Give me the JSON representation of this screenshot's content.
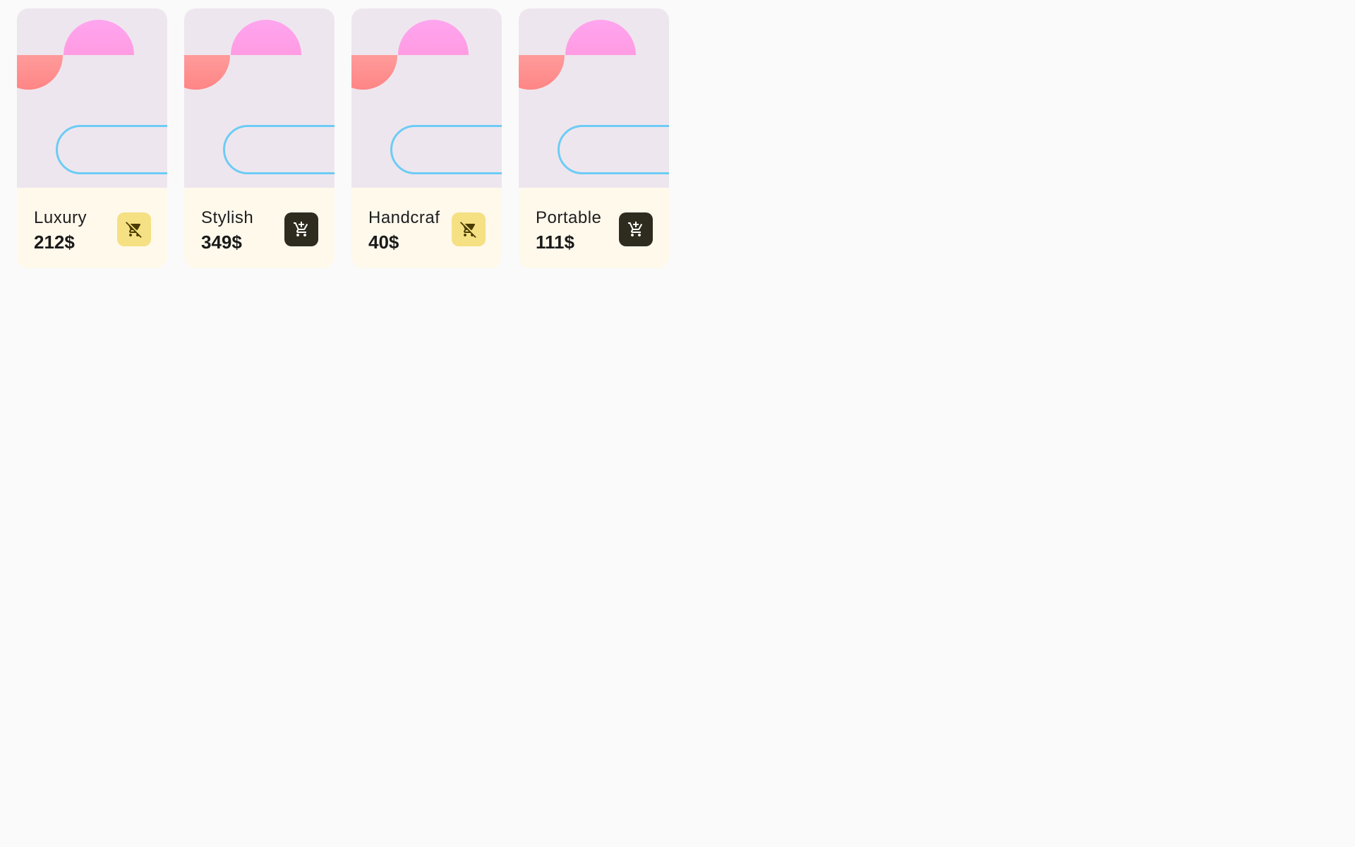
{
  "products": [
    {
      "name": "Luxury",
      "price": "212$",
      "cart_action": "remove",
      "cart_icon": "remove-shopping-cart-icon",
      "button_bg": "#F5E083",
      "icon_color": "#4A3C00"
    },
    {
      "name": "Stylish",
      "price": "349$",
      "cart_action": "add",
      "cart_icon": "add-shopping-cart-icon",
      "button_bg": "#2E2C1F",
      "icon_color": "#FFFFFF"
    },
    {
      "name": "Handcraf",
      "price": "40$",
      "cart_action": "remove",
      "cart_icon": "remove-shopping-cart-icon",
      "button_bg": "#F5E083",
      "icon_color": "#4A3C00"
    },
    {
      "name": "Portable",
      "price": "111$",
      "cart_action": "add",
      "cart_icon": "add-shopping-cart-icon",
      "button_bg": "#2E2C1F",
      "icon_color": "#FFFFFF"
    }
  ],
  "colors": {
    "background": "#FAFAFA",
    "art_background": "#EEE6EE",
    "info_background": "#FFF9EC",
    "pink_shape": "#FFA5EF",
    "salmon_shape": "#FF8F8F",
    "pill_outline": "#6CCCF5"
  }
}
